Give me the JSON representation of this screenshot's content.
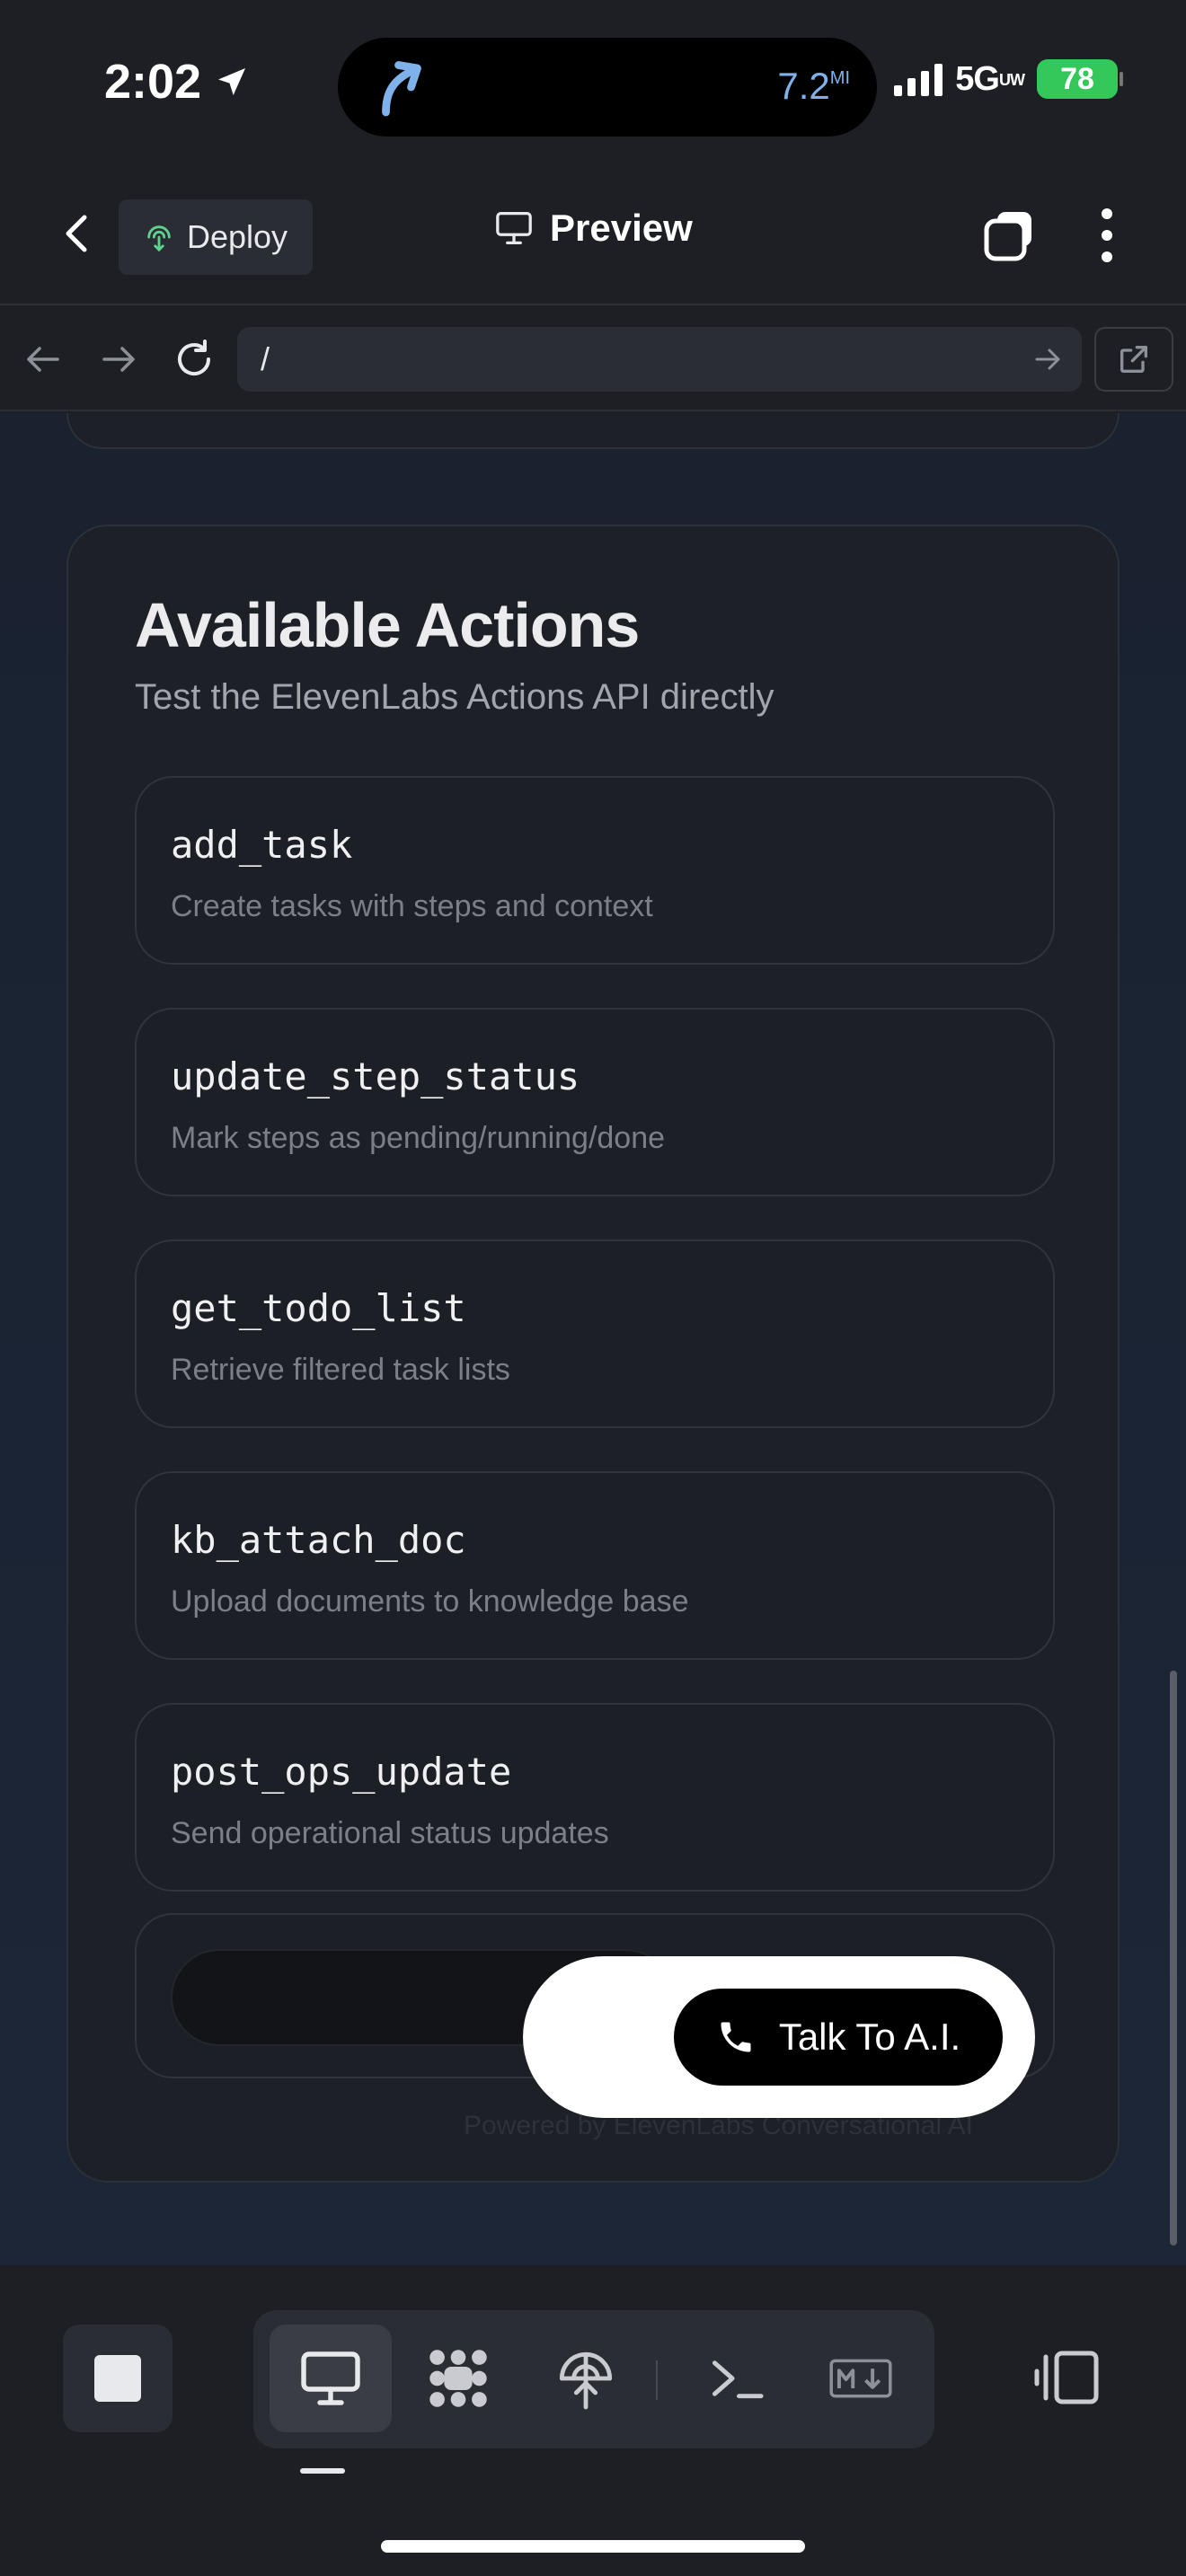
{
  "status_bar": {
    "time": "2:02",
    "nav_distance": "7.2",
    "nav_distance_unit": "MI",
    "network": "5G",
    "network_sub": "UW",
    "battery": "78"
  },
  "header": {
    "deploy_label": "Deploy",
    "title": "Preview"
  },
  "url_bar": {
    "value": "/"
  },
  "actions_panel": {
    "title": "Available Actions",
    "subtitle": "Test the ElevenLabs Actions API directly",
    "actions": [
      {
        "name": "add_task",
        "description": "Create tasks with steps and context"
      },
      {
        "name": "update_step_status",
        "description": "Mark steps as pending/running/done"
      },
      {
        "name": "get_todo_list",
        "description": "Retrieve filtered task lists"
      },
      {
        "name": "kb_attach_doc",
        "description": "Upload documents to knowledge base"
      },
      {
        "name": "post_ops_update",
        "description": "Send operational status updates"
      }
    ],
    "powered_by": "Powered by ElevenLabs Conversational AI"
  },
  "voice_widget": {
    "button_label": "Talk To A.I."
  },
  "colors": {
    "battery": "#34c759",
    "nav_accent": "#7fb2ea",
    "deploy_icon": "#5fd38d"
  },
  "icons": {
    "status": [
      "location-arrow-icon",
      "turn-arrow-icon",
      "signal-icon",
      "battery-icon"
    ],
    "header": [
      "back-chevron-icon",
      "deploy-icon",
      "monitor-icon",
      "tabs-icon",
      "more-icon"
    ],
    "url_bar": [
      "back-arrow-icon",
      "forward-arrow-icon",
      "reload-icon",
      "go-arrow-icon",
      "external-link-icon"
    ],
    "toolbar": [
      "stop-icon",
      "monitor-icon",
      "network-icon",
      "deploy-icon",
      "terminal-icon",
      "markdown-icon",
      "panel-toggle-icon"
    ]
  }
}
